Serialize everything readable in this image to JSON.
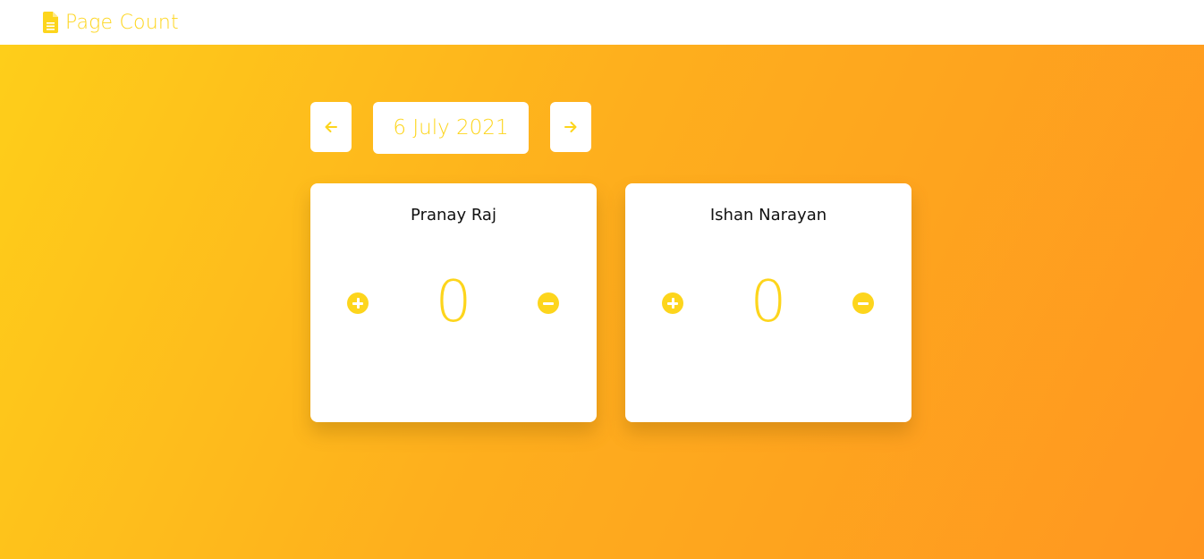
{
  "app": {
    "title": "Page Count",
    "icon": "document-icon",
    "accent_color": "#FDD51C"
  },
  "date_nav": {
    "prev_icon": "arrow-left-icon",
    "next_icon": "arrow-right-icon",
    "date": "6 July 2021"
  },
  "counters": [
    {
      "name": "Pranay Raj",
      "count": "0",
      "increment_icon": "plus-circle-icon",
      "decrement_icon": "minus-circle-icon"
    },
    {
      "name": "Ishan Narayan",
      "count": "0",
      "increment_icon": "plus-circle-icon",
      "decrement_icon": "minus-circle-icon"
    }
  ]
}
